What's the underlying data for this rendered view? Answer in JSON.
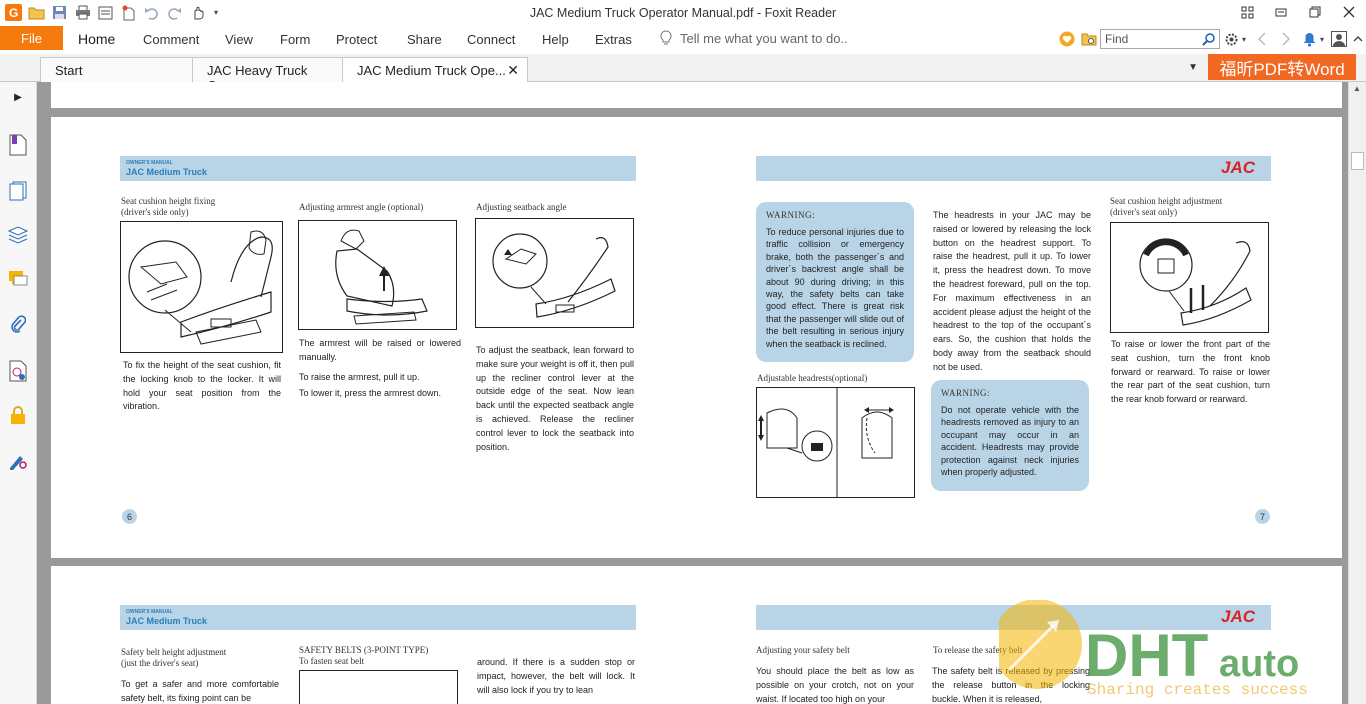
{
  "app": {
    "window_title": "JAC Medium Truck Operator Manual.pdf - Foxit Reader"
  },
  "ribbon": {
    "file_label": "File",
    "tabs": [
      {
        "label": "Home"
      },
      {
        "label": "Comment"
      },
      {
        "label": "View"
      },
      {
        "label": "Form"
      },
      {
        "label": "Protect"
      },
      {
        "label": "Share"
      },
      {
        "label": "Connect"
      },
      {
        "label": "Help"
      },
      {
        "label": "Extras"
      }
    ],
    "tell_me_placeholder": "Tell me what you want to do..",
    "find_placeholder": "Find"
  },
  "doc_tabs": [
    {
      "label": "Start"
    },
    {
      "label": "JAC Heavy Truck Ope..."
    },
    {
      "label": "JAC Medium Truck Ope..."
    }
  ],
  "promo_label": "福昕PDF转Word",
  "colors": {
    "accent_orange": "#f57a0e",
    "promo_orange": "#f26722",
    "manual_blue": "#b9d4e6",
    "jac_red": "#d8232a"
  },
  "page6": {
    "header_small": "OWNER'S MANUAL",
    "header_main": "JAC Medium Truck",
    "col1_caption_1": "Seat cushion height fixing",
    "col1_caption_2": "(driver's side only)",
    "col1_text": "To fix the height of the seat cushion, fit the locking knob to the locker. It will hold your seat position from the vibration.",
    "col2_caption": "Adjusting armrest angle (optional)",
    "col2_text_1": "The armrest will be raised or lowered manually.",
    "col2_text_2": "To raise the armrest, pull it up.",
    "col2_text_3": "To lower it, press the armrest down.",
    "col3_caption": "Adjusting seatback angle",
    "col3_text": "To adjust the seatback, lean forward to make sure your weight is off it, then pull up the recliner control lever at the outside edge of the seat. Now lean back until the expected seatback angle is achieved. Release the recliner control lever to lock the seatback into position.",
    "page_number": "6"
  },
  "page7": {
    "logo": "JAC",
    "warning1_title": "WARNING:",
    "warning1_text": "To reduce personal injuries due to traffic collision or emergency brake, both the passenger´s and driver´s backrest angle shall be about 90    during driving; in this way, the safety belts can take good effect. There is great risk that the passenger will slide out of the belt resulting in serious injury when the seatback is reclined.",
    "headrest_caption": "Adjustable headrests(optional)",
    "headrest_text": "The headrests in your JAC may be raised or lowered by releasing the lock button on the headrest support. To raise the headrest, pull it up. To lower it, press the headrest down. To move the headrest foreward, pull on the top. For maximum effectiveness in an accident please adjust the height of the headrest to the top of the occupant´s ears. So, the cushion that holds the body away from the seatback should not be used.",
    "warning2_title": "WARNING:",
    "warning2_text": "Do not operate vehicle with the headrests removed as injury to an occupant may occur in an accident. Headrests may provide protection against neck injuries when properly adjusted.",
    "col3_caption_1": "Seat cushion height adjustment",
    "col3_caption_2": "(driver's seat only)",
    "col3_text": "To raise or lower the front part of the seat cushion, turn the front knob forward or rearward. To raise or lower the rear part of the seat cushion, turn the rear knob forward or rearward.",
    "page_number": "7"
  },
  "page8": {
    "header_small": "OWNER'S MANUAL",
    "header_main": "JAC Medium Truck",
    "col1_caption_1": "Safety belt height adjustment",
    "col1_caption_2": " (just the driver's seat)",
    "col1_text": "To get a safer and more comfortable safety belt, its fixing point can be",
    "col2_caption_1": "SAFETY BELTS (3-POINT TYPE)",
    "col2_caption_2": "To fasten seat belt",
    "col3_text": "around. If there is a sudden stop or impact, however, the belt will lock. It will also lock if you try to lean"
  },
  "page9": {
    "logo": "JAC",
    "col1_caption": "Adjusting your safety belt",
    "col1_text": "You should place the belt as low as possible on your crotch, not on your waist. If located too high on your",
    "col2_caption": "To release the safety belt",
    "col2_text": "The safety belt is released by pressing the release button in the locking buckle. When it is released,"
  },
  "watermark": {
    "brand": "DHTauto",
    "slogan": "Sharing creates success"
  }
}
